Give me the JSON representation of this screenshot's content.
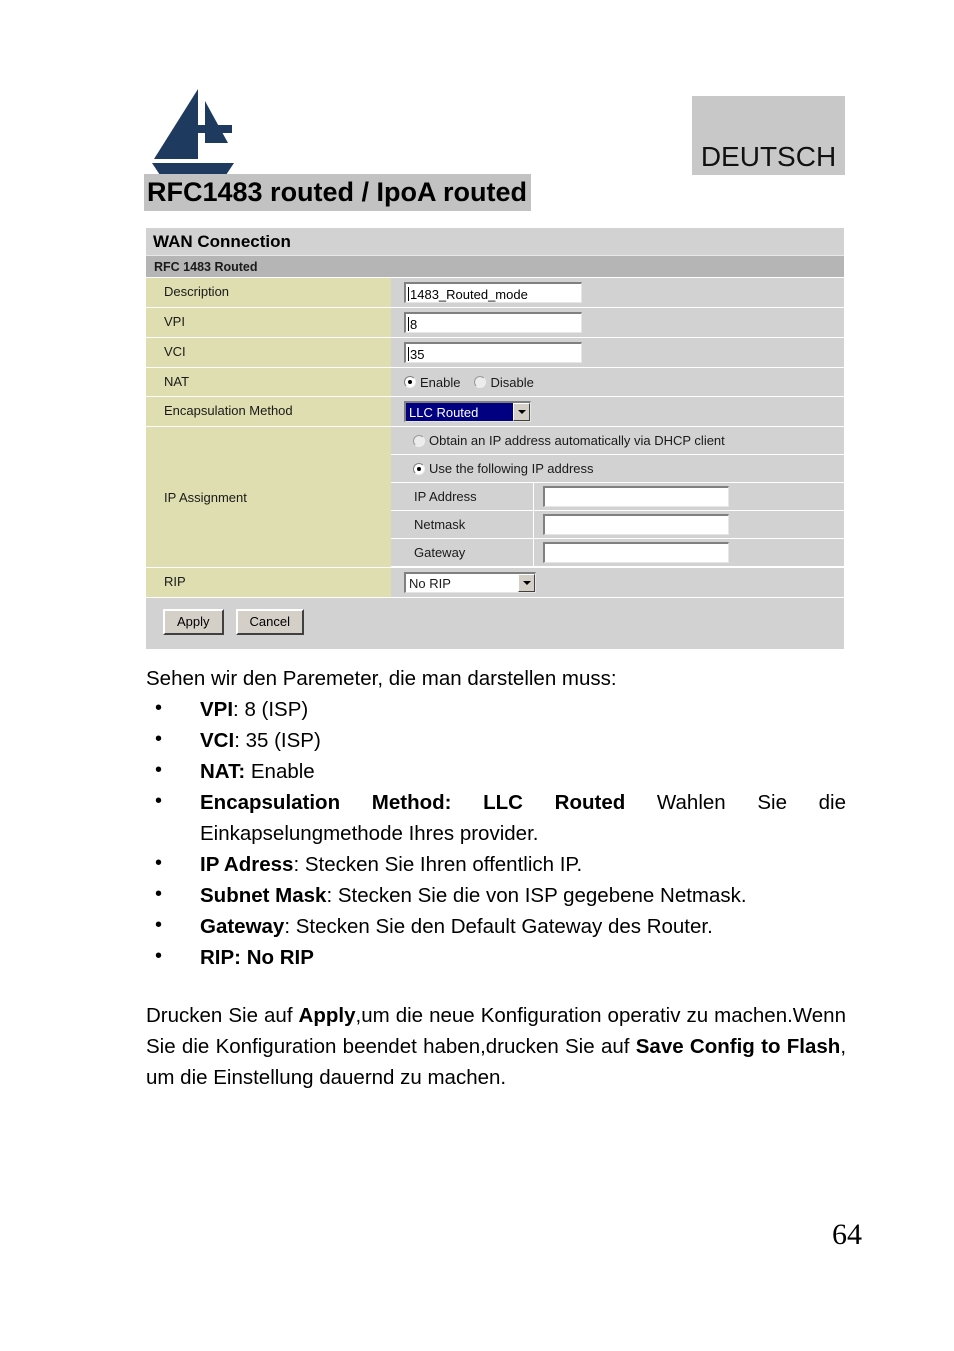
{
  "header": {
    "logo_name": "atlantis-land-logo",
    "language_badge": "DEUTSCH",
    "page_title": "RFC1483 routed / IpoA routed"
  },
  "panel": {
    "title": "WAN Connection",
    "subtitle": "RFC 1483 Routed",
    "rows": {
      "description": {
        "label": "Description",
        "value": "1483_Routed_mode"
      },
      "vpi": {
        "label": "VPI",
        "value": "8"
      },
      "vci": {
        "label": "VCI",
        "value": "35"
      },
      "nat": {
        "label": "NAT",
        "options": [
          {
            "label": "Enable",
            "selected": true
          },
          {
            "label": "Disable",
            "selected": false
          }
        ]
      },
      "encapsulation": {
        "label": "Encapsulation Method",
        "value": "LLC Routed",
        "highlighted": true
      },
      "ip_assignment": {
        "label": "IP Assignment",
        "radio_dhcp": {
          "label": "Obtain an IP address automatically via DHCP client",
          "selected": false
        },
        "radio_static": {
          "label": "Use the following IP address",
          "selected": true
        },
        "fields": [
          {
            "label": "IP Address",
            "value": ""
          },
          {
            "label": "Netmask",
            "value": ""
          },
          {
            "label": "Gateway",
            "value": ""
          }
        ]
      },
      "rip": {
        "label": "RIP",
        "value": "No RIP"
      }
    },
    "buttons": {
      "apply": "Apply",
      "cancel": "Cancel"
    }
  },
  "body": {
    "intro": "Sehen wir den Paremeter, die man darstellen muss:",
    "bullets": [
      {
        "bold": "VPI",
        "rest": ": 8 (ISP)"
      },
      {
        "bold": "VCI",
        "rest": ": 35 (ISP)"
      },
      {
        "bold": "NAT:",
        "rest": " Enable"
      },
      {
        "bold": "Encapsulation Method: LLC Routed",
        "rest": " Wahlen Sie die Einkapselungmethode Ihres provider."
      },
      {
        "bold": "IP Adress",
        "rest": ": Stecken Sie Ihren offentlich IP."
      },
      {
        "bold": "Subnet Mask",
        "rest": ": Stecken Sie  die von ISP gegebene Netmask."
      },
      {
        "bold": "Gateway",
        "rest": ": Stecken Sie den Default Gateway des Router."
      },
      {
        "bold": "RIP: No RIP",
        "rest": ""
      }
    ],
    "paragraph": {
      "part1": "Drucken Sie auf ",
      "bold1": "Apply",
      "part2": ",um die neue Konfiguration operativ zu machen.Wenn Sie die Konfiguration beendet haben,drucken Sie auf  ",
      "bold2": "Save Config to Flash",
      "part3": ", um die Einstellung dauernd zu machen."
    }
  },
  "footer": {
    "page_number": "64"
  },
  "colors": {
    "label_cell": "#dedeb0",
    "value_cell": "#d2d2d2",
    "subheader": "#b5b5b5",
    "highlight": "#000080",
    "logo": "#1f3a5f",
    "badge_bg": "#c8c8c8",
    "title_bg": "#c2c2c2"
  }
}
